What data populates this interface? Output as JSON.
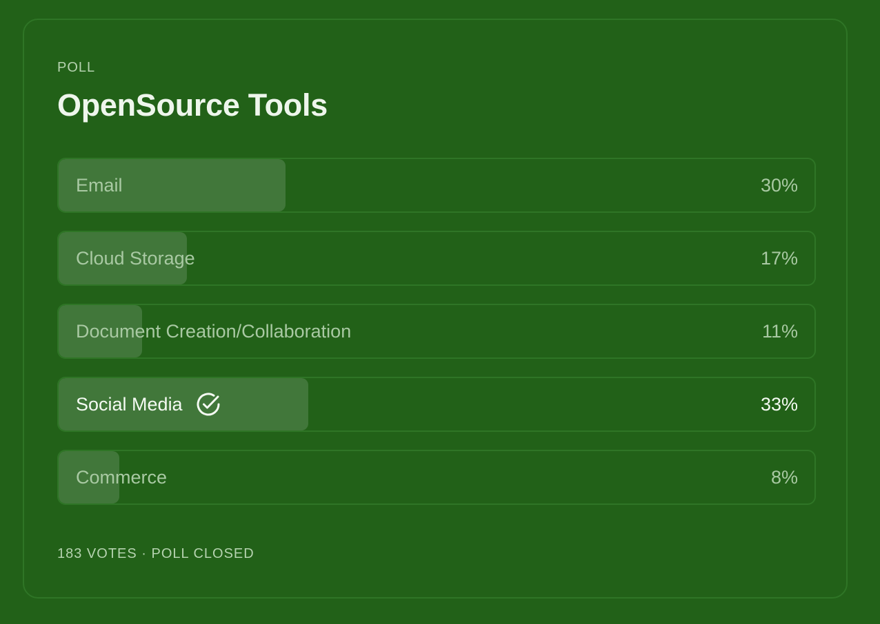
{
  "poll": {
    "eyebrow": "POLL",
    "title": "OpenSource Tools",
    "options": [
      {
        "label": "Email",
        "percent_label": "30%",
        "percent": 30,
        "selected": false
      },
      {
        "label": "Cloud Storage",
        "percent_label": "17%",
        "percent": 17,
        "selected": false
      },
      {
        "label": "Document Creation/Collaboration",
        "percent_label": "11%",
        "percent": 11,
        "selected": false
      },
      {
        "label": "Social Media",
        "percent_label": "33%",
        "percent": 33,
        "selected": true,
        "icon": "check-circle-icon"
      },
      {
        "label": "Commerce",
        "percent_label": "8%",
        "percent": 8,
        "selected": false
      }
    ],
    "footer": "183 VOTES · POLL CLOSED"
  },
  "colors": {
    "background": "#226118",
    "border": "#2f7526",
    "fill": "#41773a",
    "text_muted": "#a9c9a3",
    "text_selected": "#f4faf2"
  }
}
